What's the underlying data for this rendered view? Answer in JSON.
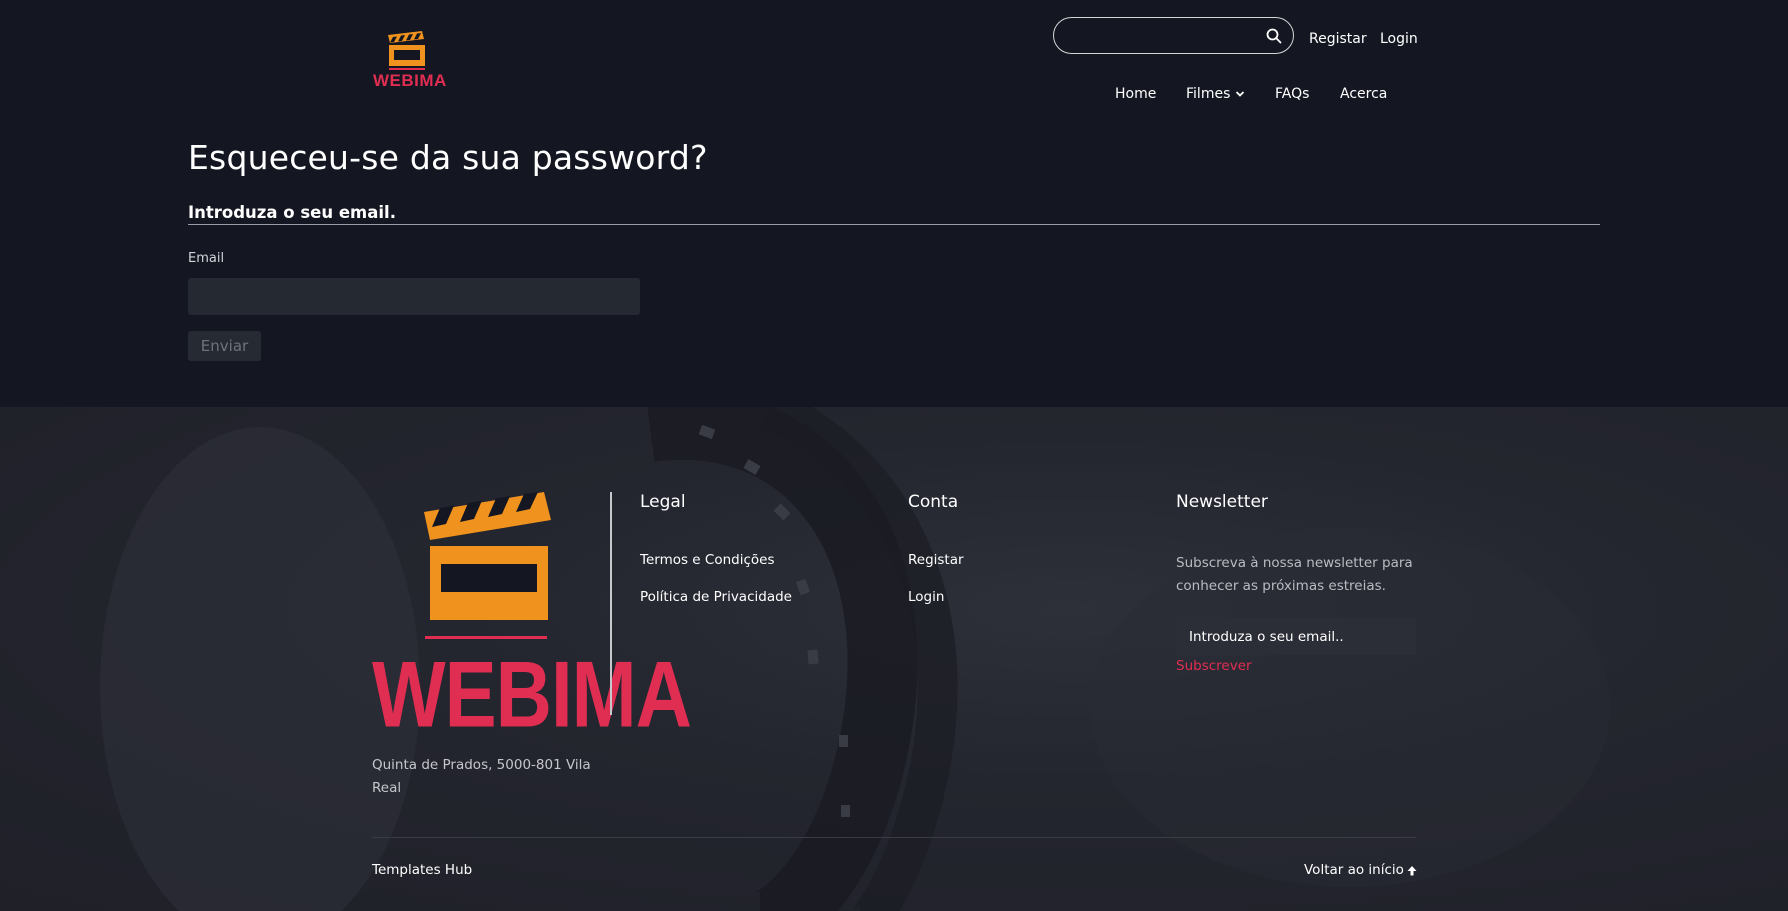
{
  "header": {
    "brand": "WEBIMA",
    "search": {
      "value": "",
      "placeholder": ""
    },
    "top_links": [
      "Registar",
      "Login"
    ],
    "nav": [
      "Home",
      "Filmes",
      "FAQs",
      "Acerca"
    ]
  },
  "main": {
    "title": "Esqueceu-se da sua password?",
    "subtitle": "Introduza o seu email.",
    "email_label": "Email",
    "email_value": "",
    "submit_label": "Enviar"
  },
  "footer": {
    "brand": "WEBIMA",
    "address": "Quinta de Prados, 5000-801 Vila Real",
    "legal": {
      "title": "Legal",
      "links": [
        "Termos e Condições",
        "Política de Privacidade"
      ]
    },
    "account": {
      "title": "Conta",
      "links": [
        "Registar",
        "Login"
      ]
    },
    "newsletter": {
      "title": "Newsletter",
      "text": "Subscreva à nossa newsletter para conhecer as próximas estreias.",
      "placeholder": "Introduza o seu email..",
      "button": "Subscrever"
    },
    "credit": "Templates Hub",
    "back_to_top": "Voltar ao início"
  },
  "colors": {
    "background": "#141722",
    "brand_orange": "#f0921e",
    "brand_red": "#e02d52"
  }
}
